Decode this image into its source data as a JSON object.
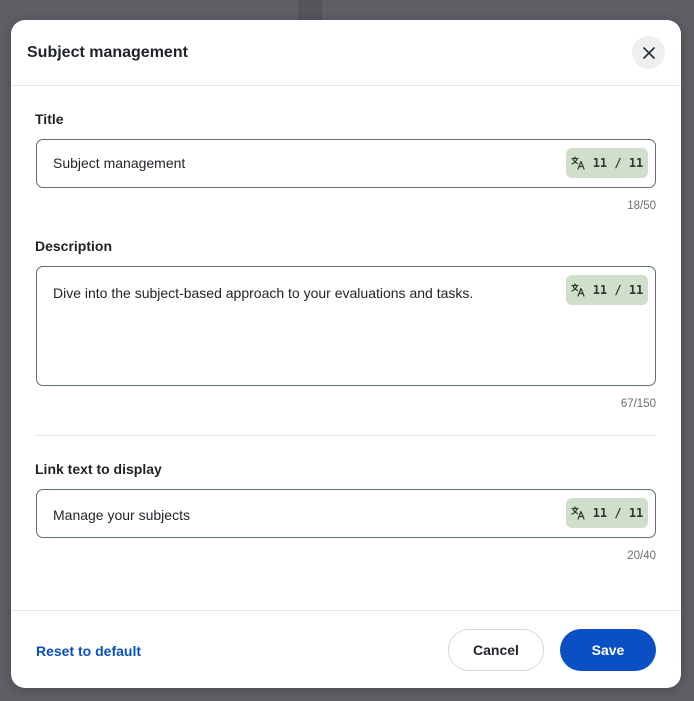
{
  "colors": {
    "backdrop": "#5f6066",
    "badge_bg": "#cfdfcb",
    "primary": "#0a4fc4",
    "link": "#0a4fb8",
    "field_border": "#5c6f6a"
  },
  "modal": {
    "title": "Subject management",
    "close_icon": "close-icon"
  },
  "fields": {
    "title": {
      "label": "Title",
      "value": "Subject management",
      "badge": "11 / 11",
      "counter": "18/50"
    },
    "description": {
      "label": "Description",
      "value": "Dive into the subject-based approach to your evaluations and tasks.",
      "badge": "11 / 11",
      "counter": "67/150"
    },
    "link_text": {
      "label": "Link text to display",
      "value": "Manage your subjects",
      "badge": "11 / 11",
      "counter": "20/40"
    }
  },
  "badge_icon": "translate-icon",
  "footer": {
    "reset": "Reset to default",
    "cancel": "Cancel",
    "save": "Save"
  }
}
